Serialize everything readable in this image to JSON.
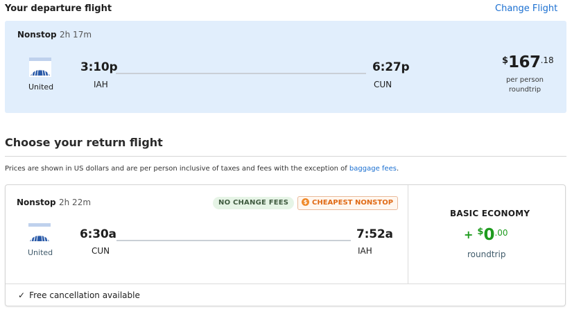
{
  "departure": {
    "heading": "Your departure flight",
    "change_label": "Change Flight",
    "stops": "Nonstop",
    "duration": "2h 17m",
    "airline": "United",
    "depart_time": "3:10p",
    "depart_code": "IAH",
    "arrive_time": "6:27p",
    "arrive_code": "CUN",
    "price_symbol": "$",
    "price_int": "167",
    "price_cents": ".18",
    "price_note_1": "per person",
    "price_note_2": "roundtrip"
  },
  "return_section": {
    "heading": "Choose your return flight",
    "notice_text": "Prices are shown in US dollars and are per person inclusive of taxes and fees with the exception of ",
    "notice_link": "baggage fees",
    "notice_end": "."
  },
  "return_flight": {
    "stops": "Nonstop",
    "duration": "2h 22m",
    "badge_no_change": "NO CHANGE FEES",
    "badge_cheapest": "CHEAPEST NONSTOP",
    "airline": "United",
    "depart_time": "6:30a",
    "depart_code": "CUN",
    "arrive_time": "7:52a",
    "arrive_code": "IAH",
    "fare_name": "BASIC ECONOMY",
    "fare_plus": "+",
    "fare_symbol": "$",
    "fare_int": "0",
    "fare_cents": ".00",
    "fare_sub": "roundtrip",
    "free_cancel": "Free cancellation available"
  },
  "icons": {
    "airline_logo": "united-globe-icon",
    "badge_cheapest_icon": "dollar-coin-icon",
    "check": "checkmark-icon"
  },
  "colors": {
    "accent_link": "#1a6fd1",
    "departure_bg": "#e1eefc",
    "price_green": "#1e9b1e",
    "badge_orange": "#e06a15"
  }
}
